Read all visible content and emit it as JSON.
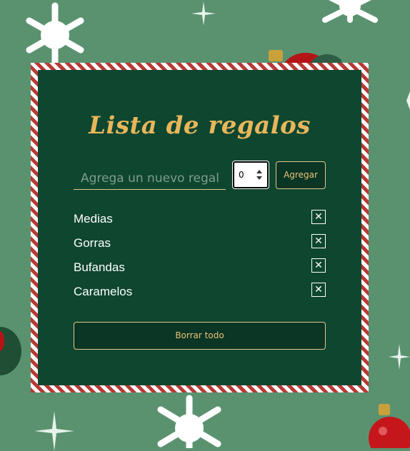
{
  "app": {
    "title": "Lista de regalos"
  },
  "form": {
    "gift_placeholder": "Agrega un nuevo regalo",
    "gift_value": "",
    "quantity_value": "0",
    "add_label": "Agregar"
  },
  "gifts": [
    {
      "name": "Medias",
      "remove_icon": "✕"
    },
    {
      "name": "Gorras",
      "remove_icon": "✕"
    },
    {
      "name": "Bufandas",
      "remove_icon": "✕"
    },
    {
      "name": "Caramelos",
      "remove_icon": "✕"
    }
  ],
  "actions": {
    "clear_all_label": "Borrar todo"
  },
  "theme": {
    "background": "#5a9270",
    "card": "#0e4630",
    "accent": "#e8b65a",
    "stripe_red": "#b73a35",
    "stripe_white": "#ffffff"
  },
  "decorations": [
    "snowflake-icon",
    "ornament-ball-icon",
    "sparkle-icon"
  ]
}
